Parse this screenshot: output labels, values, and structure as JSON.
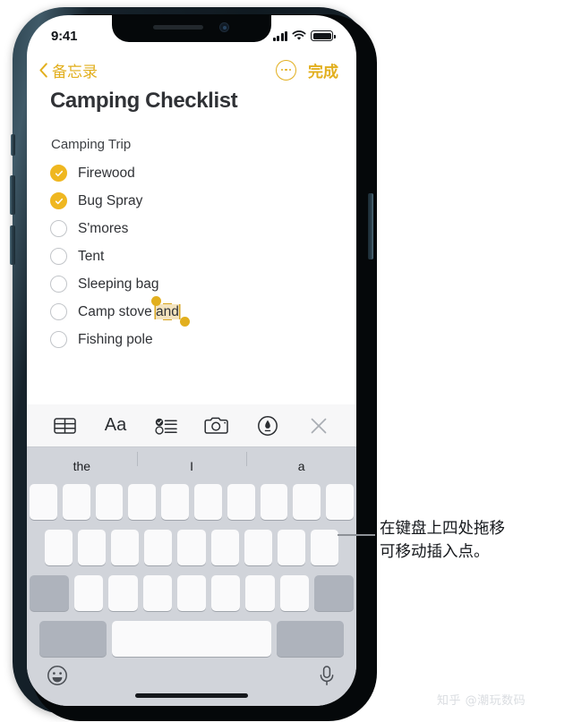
{
  "status_bar": {
    "time": "9:41",
    "signal_icon": "cellular-signal-icon",
    "wifi_icon": "wifi-icon",
    "battery_icon": "battery-icon"
  },
  "nav_bar": {
    "back_label": "备忘录",
    "back_icon": "chevron-left-icon",
    "more_icon": "more-circle-icon",
    "done_label": "完成"
  },
  "note": {
    "title": "Camping Checklist",
    "subtitle": "Camping Trip",
    "items": [
      {
        "label": "Firewood",
        "checked": true
      },
      {
        "label": "Bug Spray",
        "checked": true
      },
      {
        "label": "S'mores",
        "checked": false
      },
      {
        "label": "Tent",
        "checked": false
      },
      {
        "label": "Sleeping bag",
        "checked": false
      },
      {
        "label": "Camp stove ",
        "checked": false,
        "selected_text": "and"
      },
      {
        "label": "Fishing pole",
        "checked": false
      }
    ]
  },
  "format_toolbar": {
    "items": [
      {
        "name": "table-icon",
        "label": "Table"
      },
      {
        "name": "text-format-icon",
        "label": "Aa"
      },
      {
        "name": "checklist-icon",
        "label": "Checklist"
      },
      {
        "name": "camera-icon",
        "label": "Camera"
      },
      {
        "name": "markup-pen-icon",
        "label": "Markup"
      },
      {
        "name": "close-icon",
        "label": "Close"
      }
    ]
  },
  "keyboard": {
    "predictive": [
      "the",
      "I",
      "a"
    ],
    "emoji_icon": "emoji-icon",
    "mic_icon": "microphone-icon"
  },
  "callout": {
    "text": "在键盘上四处拖移\n可移动插入点。"
  },
  "watermark": {
    "text": "知乎 @潮玩数码"
  },
  "colors": {
    "accent": "#E2AF1E",
    "checkbox_checked": "#EFB720",
    "selection_fill": "#F3E3BE",
    "keyboard_bg": "#D1D4DA",
    "key_bg": "#FAFAFB",
    "key_dark_bg": "#AEB3BC",
    "text": "#303236"
  }
}
